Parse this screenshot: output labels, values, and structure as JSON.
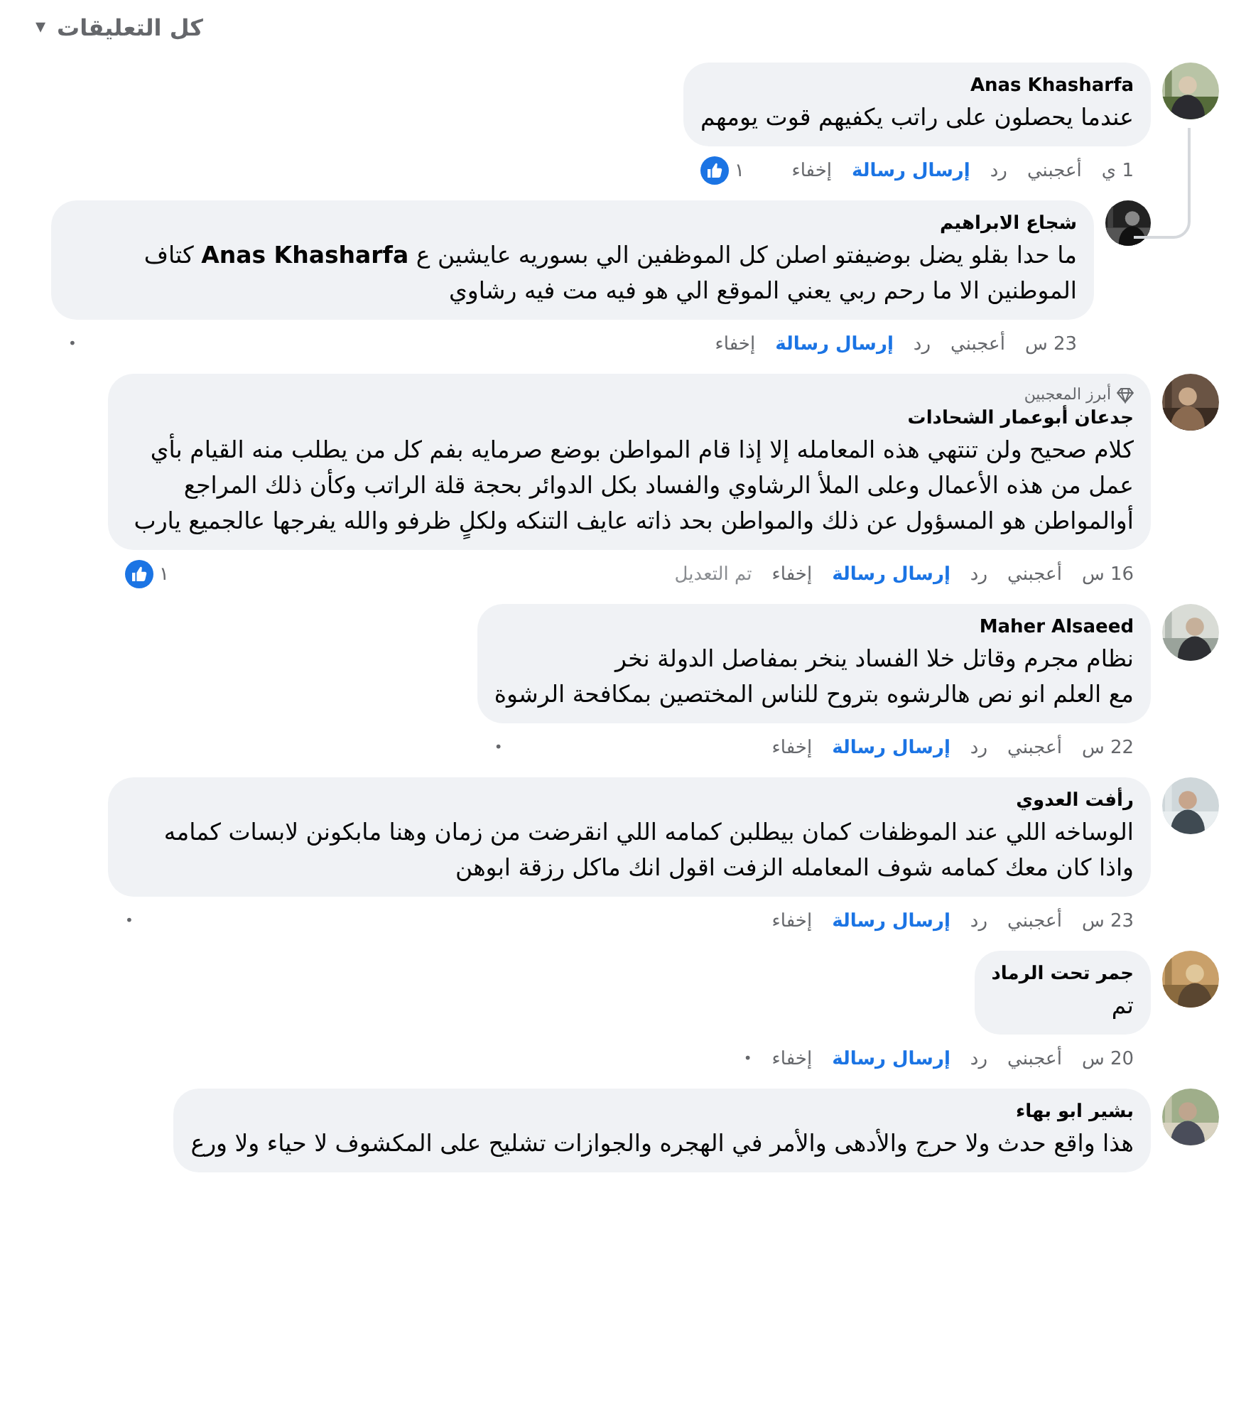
{
  "header": {
    "label": "كل التعليقات",
    "caret": "▾"
  },
  "comments": [
    {
      "author": "Anas Khasharfa",
      "text": "عندما يحصلون على راتب يكفيهم قوت يومهم",
      "time": "1 ي",
      "actions": [
        {
          "label": "أعجبني",
          "kind": "plain"
        },
        {
          "label": "رد",
          "kind": "plain"
        },
        {
          "label": "إرسال رسالة",
          "kind": "message"
        },
        {
          "label": "إخفاء",
          "kind": "plain"
        }
      ],
      "reaction_count": "١",
      "replies": [
        {
          "author": "شجاع الابراهيم",
          "text": "ما حدا بقلو يضل بوضيفتو اصلن كل الموظفين الي بسوريه عايشين ع **Anas Khasharfa** كتاف الموطنين الا ما رحم ربي يعني الموقع الي هو فيه مت فيه رشاوي",
          "time": "23 س",
          "actions": [
            {
              "label": "أعجبني",
              "kind": "plain"
            },
            {
              "label": "رد",
              "kind": "plain"
            },
            {
              "label": "إرسال رسالة",
              "kind": "message"
            },
            {
              "label": "إخفاء",
              "kind": "plain"
            }
          ],
          "dot": "•"
        }
      ]
    },
    {
      "badge": "أبرز المعجبين",
      "author": "جدعان أبوعمار الشحادات",
      "text": "كلام صحيح ولن تنتهي هذه المعامله إلا إذا قام المواطن بوضع صرمايه بفم كل من يطلب منه القيام بأي عمل من هذه الأعمال وعلى الملأ الرشاوي والفساد بكل الدوائر بحجة قلة الراتب وكأن ذلك المراجع أوالمواطن هو المسؤول عن ذلك والمواطن بحد ذاته عايف التنكه ولكلٍ ظرفو والله يفرجها عالجميع يارب",
      "time": "16 س",
      "actions": [
        {
          "label": "أعجبني",
          "kind": "plain"
        },
        {
          "label": "رد",
          "kind": "plain"
        },
        {
          "label": "إرسال رسالة",
          "kind": "message"
        },
        {
          "label": "إخفاء",
          "kind": "plain"
        }
      ],
      "edited_note": "تم التعديل",
      "reaction_count": "١"
    },
    {
      "author": "Maher Alsaeed",
      "text": "نظام مجرم وقاتل خلا الفساد ينخر بمفاصل الدولة نخر\nمع العلم انو نص هالرشوه بتروح للناس المختصين بمكافحة الرشوة",
      "time": "22 س",
      "actions": [
        {
          "label": "أعجبني",
          "kind": "plain"
        },
        {
          "label": "رد",
          "kind": "plain"
        },
        {
          "label": "إرسال رسالة",
          "kind": "message"
        },
        {
          "label": "إخفاء",
          "kind": "plain"
        }
      ],
      "dot": "•"
    },
    {
      "author": "رأفت العدوي",
      "text": "الوساخه اللي عند الموظفات كمان بيطلبن كمامه اللي انقرضت من زمان وهنا مابكونن لابسات كمامه واذا كان معك كمامه شوف المعامله الزفت اقول انك ماكل رزقة ابوهن",
      "time": "23 س",
      "actions": [
        {
          "label": "أعجبني",
          "kind": "plain"
        },
        {
          "label": "رد",
          "kind": "plain"
        },
        {
          "label": "إرسال رسالة",
          "kind": "message"
        },
        {
          "label": "إخفاء",
          "kind": "plain"
        }
      ],
      "dot": "•"
    },
    {
      "author": "جمر تحت الرماد",
      "text": "تم",
      "time": "20 س",
      "actions": [
        {
          "label": "أعجبني",
          "kind": "plain"
        },
        {
          "label": "رد",
          "kind": "plain"
        },
        {
          "label": "إرسال رسالة",
          "kind": "message"
        },
        {
          "label": "إخفاء",
          "kind": "plain"
        }
      ],
      "dot": "•"
    },
    {
      "author": "بشير ابو بهاء",
      "text": "هذا واقع حدث ولا حرج والأدهى والأمر في الهجره والجوازات تشليح على المكشوف لا حياء ولا ورع"
    }
  ]
}
